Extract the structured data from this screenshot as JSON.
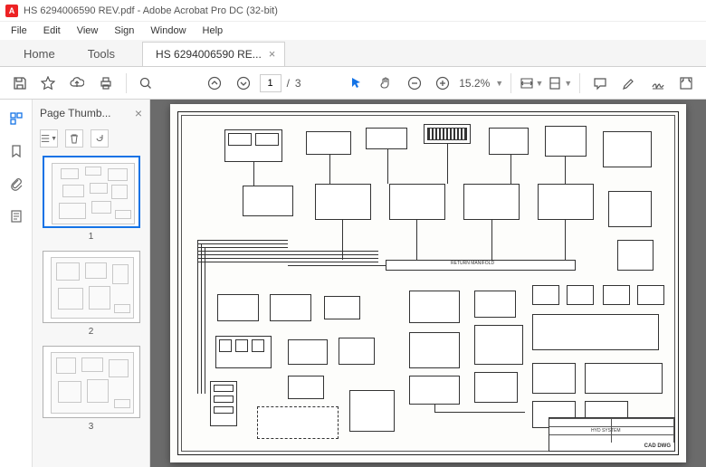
{
  "titlebar": {
    "app_icon_letter": "A",
    "title": "HS 6294006590 REV.pdf - Adobe Acrobat Pro DC (32-bit)"
  },
  "menubar": {
    "items": [
      "File",
      "Edit",
      "View",
      "Sign",
      "Window",
      "Help"
    ]
  },
  "tabs": {
    "home": "Home",
    "tools": "Tools",
    "doc_tab": "HS 6294006590 RE...",
    "close_glyph": "×"
  },
  "toolbar": {
    "page_current": "1",
    "page_sep": "/",
    "page_total": "3",
    "zoom_value": "15.2%"
  },
  "thumbs": {
    "title": "Page Thumb...",
    "close_glyph": "×",
    "pages": [
      "1",
      "2",
      "3"
    ]
  },
  "schematic": {
    "return_manifold": "RETURN MANIFOLD",
    "cad_dwg": "CAD DWG",
    "title_line": "HYD SYSTEM"
  }
}
